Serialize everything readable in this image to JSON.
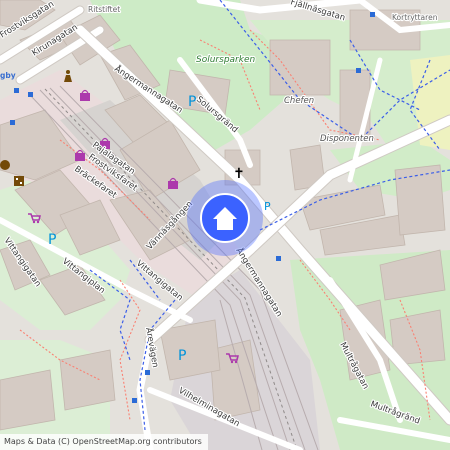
{
  "map": {
    "streets": {
      "ritsstiftet": "Ritstiftet",
      "fjallnasgatan": "Fjällnäsgatan",
      "kortryttaren": "Kortryttaren",
      "frostviksgatan": "Frostviksgatan",
      "kirunagatan": "Kirunagatan",
      "angermannagatan_north": "Ångermannagatan",
      "angermannagatan_south": "Ångermannagatan",
      "solursgrand": "Solursgränd",
      "pajalagatan": "Pajalagatan",
      "frostviksfaret": "Frostviksfaret",
      "brackefaret": "Bräckefaret",
      "vannasgangen": "Vännäsgången",
      "vittangigatan": "Vittangigatan",
      "vittangigatan_west": "Vittangigatan",
      "vittangiplan": "Vittangiplan",
      "arevagen": "Årevägen",
      "vilhelminagatan": "Vilhelminagatan",
      "multragatan": "Multrågatan",
      "multragrand": "Multrågränd"
    },
    "places": {
      "solursparken": "Solursparken",
      "chefen": "Chefen",
      "disponenten": "Disponenten",
      "station_partial": "gby"
    },
    "parking_symbol": "P",
    "church_symbol": "✝",
    "attribution": "Maps & Data (C) OpenStreetMap.org contributors",
    "colors": {
      "background": "#f2efe9",
      "building": "#d9d0c9",
      "residential": "#e0dfdf",
      "park": "#c8facc",
      "commercial": "#f2dad9",
      "rail": "#aaa4a4",
      "footpath": "#fa8072",
      "cycleway": "#3b5ee8",
      "marker": "#3b62ff"
    }
  }
}
